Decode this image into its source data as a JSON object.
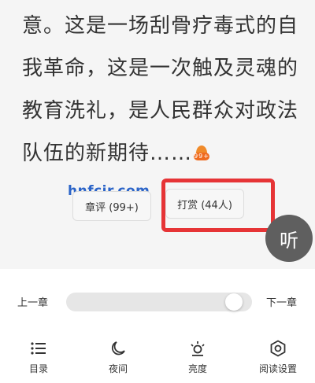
{
  "reader": {
    "lines": [
      "意。这是一场刮骨疗毒式的自",
      "我革命，这是一次触及灵魂的",
      "教育洗礼，是人民群众对政法",
      "队伍的新期待……"
    ],
    "hot_badge": "99+",
    "watermark": "hnfcjr.com",
    "comment_button": "章评 (99+)",
    "tip_button": "打赏 (44人)",
    "listen_button": "听"
  },
  "chapter_nav": {
    "prev": "上一章",
    "next": "下一章",
    "progress": 0.95
  },
  "toolbar": {
    "items": [
      {
        "label": "目录",
        "icon": "list-icon"
      },
      {
        "label": "夜间",
        "icon": "moon-icon"
      },
      {
        "label": "亮度",
        "icon": "brightness-icon"
      },
      {
        "label": "阅读设置",
        "icon": "settings-icon"
      }
    ]
  },
  "colors": {
    "highlight": "#e63436",
    "watermark": "#2b64c8",
    "badge": "#ef6b1f"
  }
}
